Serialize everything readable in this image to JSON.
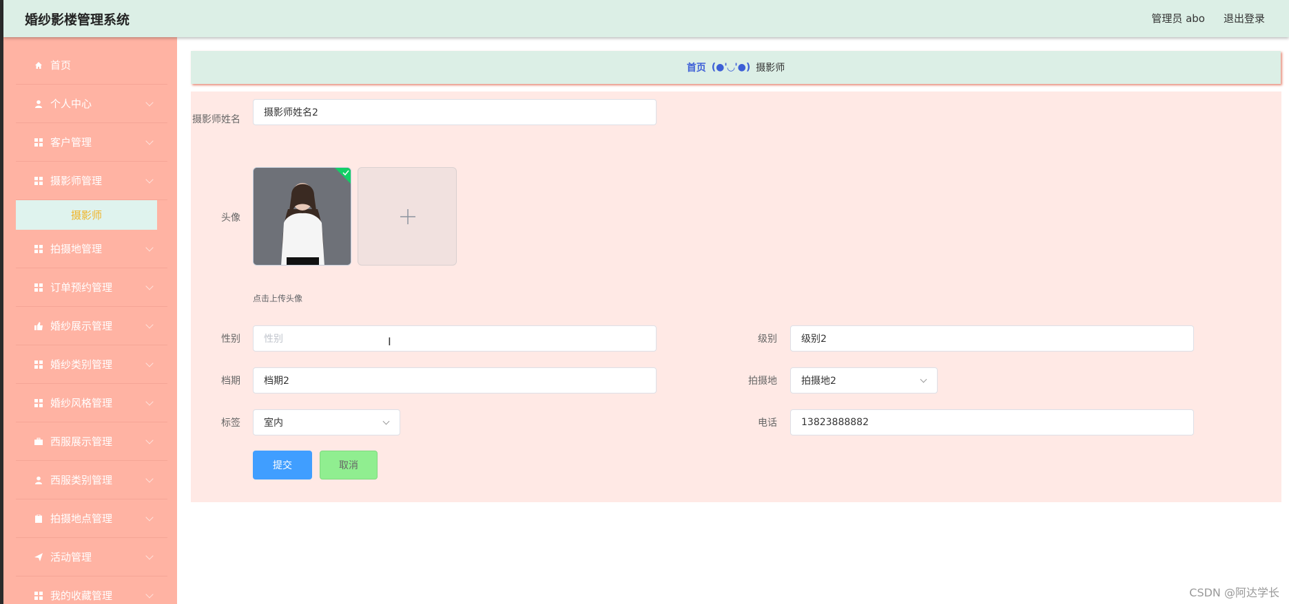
{
  "header": {
    "app_title": "婚纱影楼管理系统",
    "user": "管理员 abo",
    "logout": "退出登录",
    "bg_color": "#dcefe6"
  },
  "sidebar": {
    "bg_color": "#ffb3a3",
    "items": [
      {
        "label": "首页",
        "icon": "home-icon"
      },
      {
        "label": "个人中心",
        "icon": "user-icon"
      },
      {
        "label": "客户管理",
        "icon": "grid-icon"
      },
      {
        "label": "摄影师管理",
        "icon": "grid-icon",
        "sub_items": [
          {
            "label": "摄影师",
            "active": true
          }
        ]
      },
      {
        "label": "拍摄地管理",
        "icon": "grid-icon"
      },
      {
        "label": "订单预约管理",
        "icon": "grid-icon"
      },
      {
        "label": "婚纱展示管理",
        "icon": "thumb-icon"
      },
      {
        "label": "婚纱类别管理",
        "icon": "grid-icon"
      },
      {
        "label": "婚纱风格管理",
        "icon": "grid-icon"
      },
      {
        "label": "西服展示管理",
        "icon": "briefcase-icon"
      },
      {
        "label": "西服类别管理",
        "icon": "user-icon"
      },
      {
        "label": "拍摄地点管理",
        "icon": "clipboard-icon"
      },
      {
        "label": "活动管理",
        "icon": "send-icon"
      },
      {
        "label": "我的收藏管理",
        "icon": "grid-icon"
      }
    ]
  },
  "breadcrumb": {
    "home": "首页",
    "separator": "(●'◡'●)",
    "current": "摄影师"
  },
  "form": {
    "name_label": "摄影师姓名",
    "name_value": "摄影师姓名2",
    "avatar_label": "头像",
    "upload_tip": "点击上传头像",
    "gender_label": "性别",
    "gender_placeholder": "性别",
    "level_label": "级别",
    "level_value": "级别2",
    "schedule_label": "档期",
    "schedule_value": "档期2",
    "location_label": "拍摄地",
    "location_value": "拍摄地2",
    "tag_label": "标签",
    "tag_value": "室内",
    "phone_label": "电话",
    "phone_value": "13823888882",
    "submit": "提交",
    "cancel": "取消"
  },
  "watermark": "CSDN @阿达学长"
}
